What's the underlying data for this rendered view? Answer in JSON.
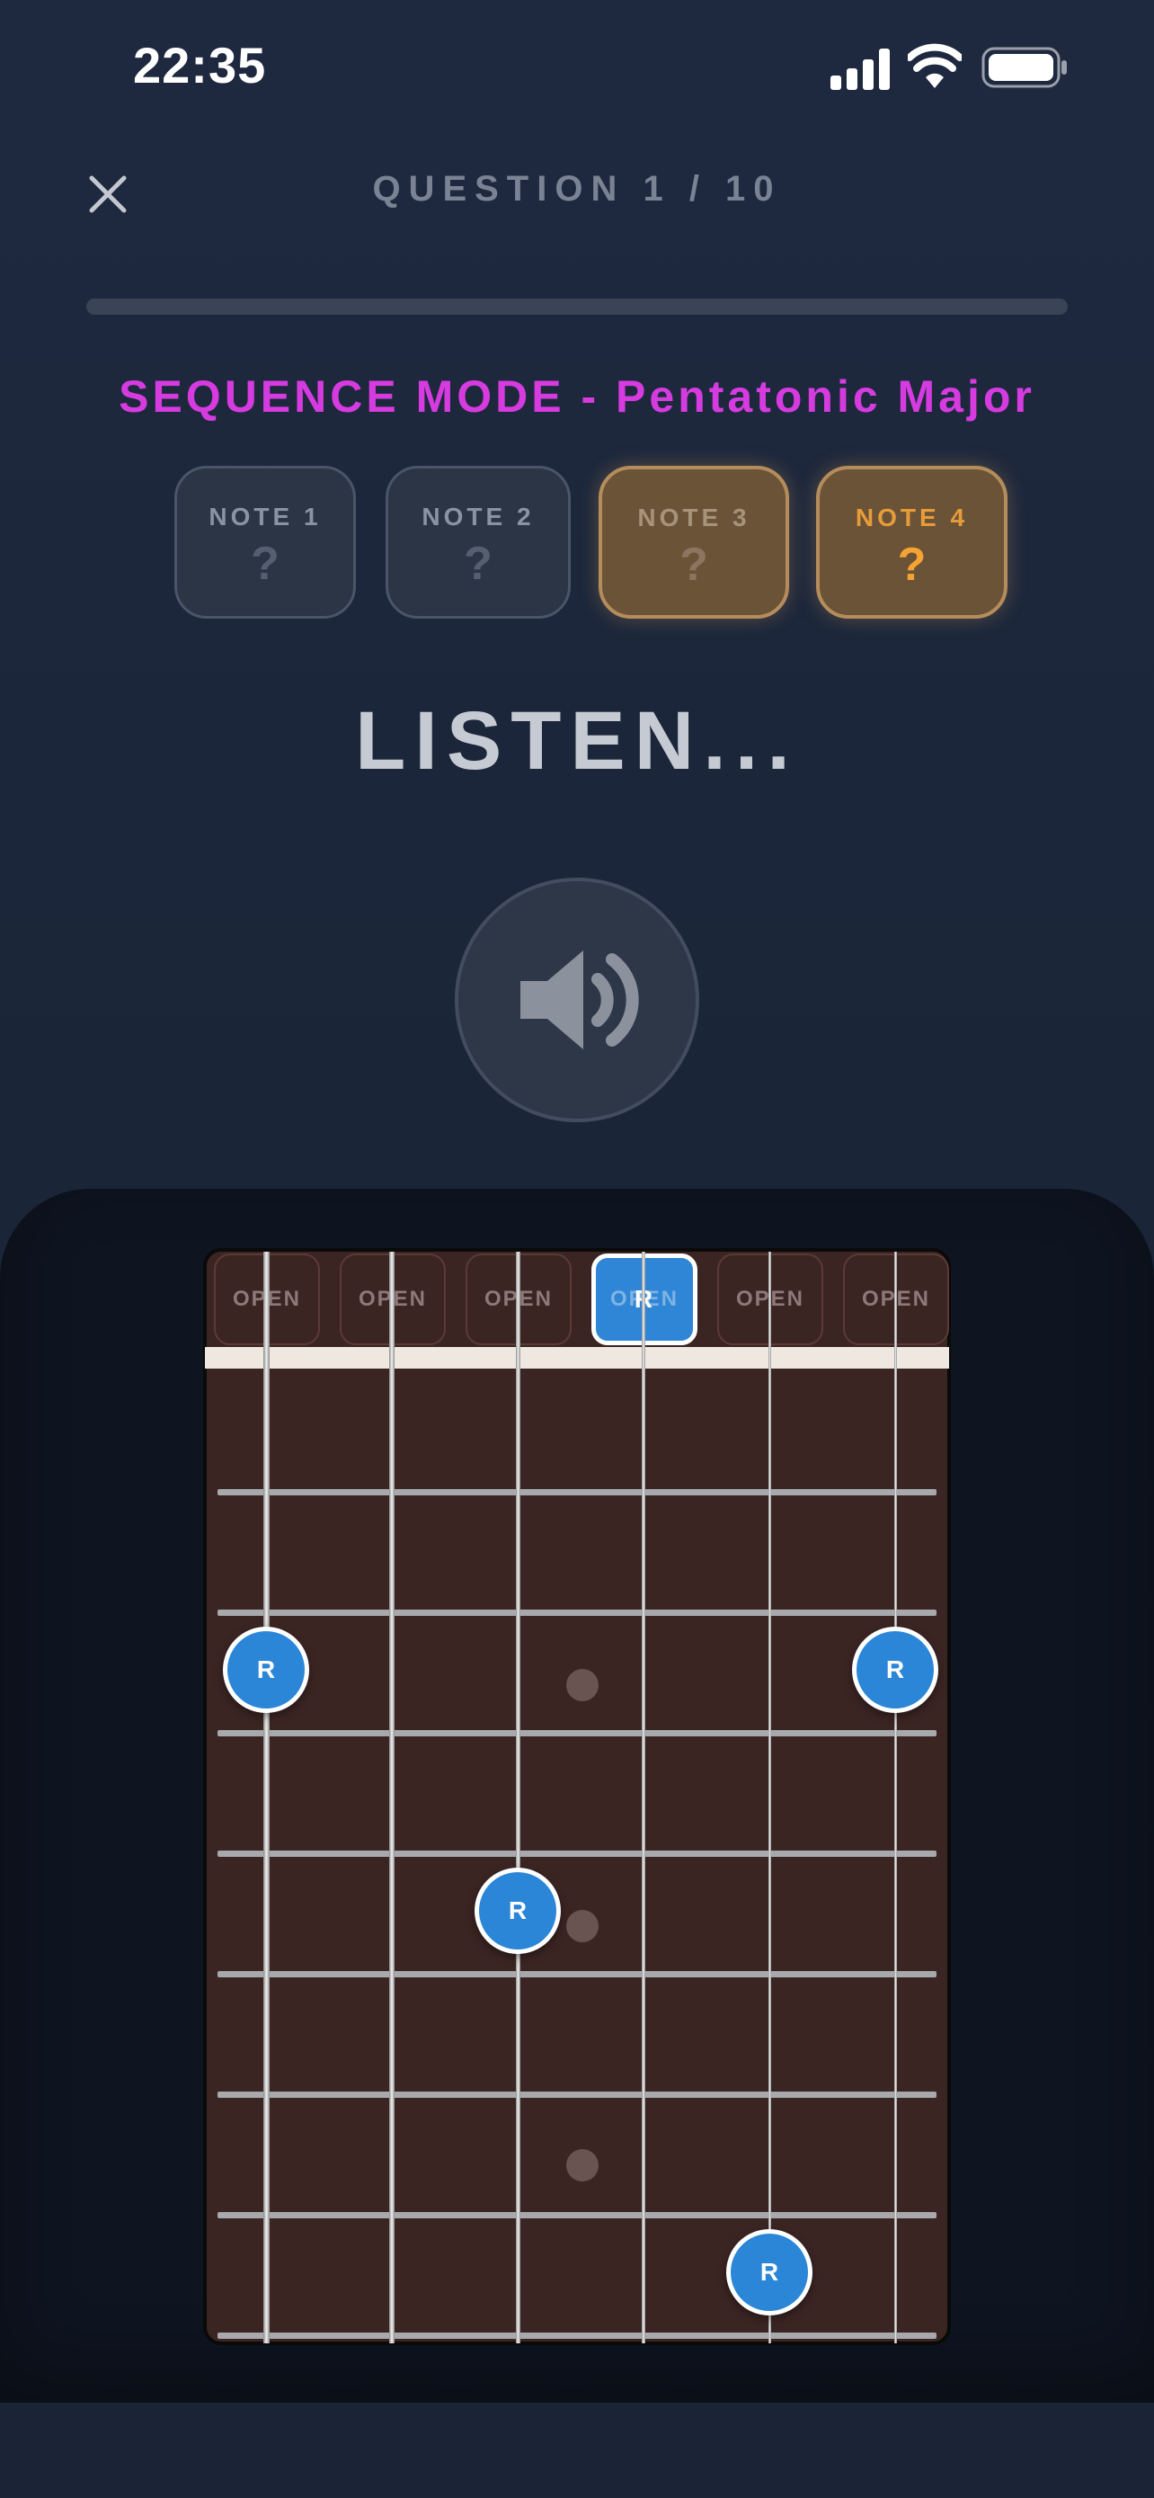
{
  "status_bar": {
    "time": "22:35"
  },
  "header": {
    "question_counter": "QUESTION 1 / 10",
    "progress": 0.0
  },
  "mode_title": "SEQUENCE MODE - Pentatonic Major",
  "note_slots": [
    {
      "label": "NOTE 1",
      "value": "?",
      "state": "idle"
    },
    {
      "label": "NOTE 2",
      "value": "?",
      "state": "idle"
    },
    {
      "label": "NOTE 3",
      "value": "?",
      "state": "highlighted"
    },
    {
      "label": "NOTE 4",
      "value": "?",
      "state": "active"
    }
  ],
  "prompt": "LISTEN...",
  "fretboard": {
    "open_labels": [
      "OPEN",
      "OPEN",
      "OPEN",
      "OPEN",
      "OPEN",
      "OPEN"
    ],
    "open_root_string": 4,
    "open_root_label": "R",
    "marker_label": "R",
    "root_positions": [
      {
        "string": 1,
        "fret": 3
      },
      {
        "string": 6,
        "fret": 3
      },
      {
        "string": 3,
        "fret": 5
      },
      {
        "string": 5,
        "fret": 8
      }
    ]
  },
  "colors": {
    "accent_purple": "#d63be0",
    "active_orange": "#f5a333",
    "note_blue": "#2b86d8"
  }
}
